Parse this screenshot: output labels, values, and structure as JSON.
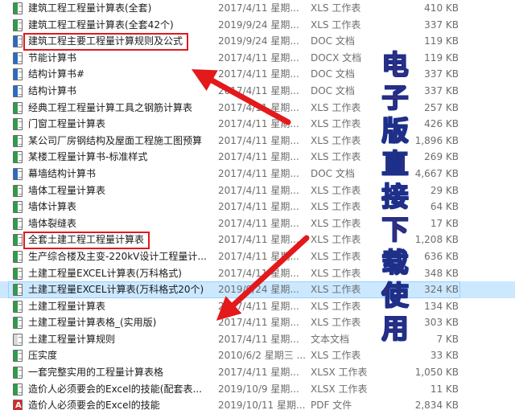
{
  "files": [
    {
      "name": "建筑工程工程量计算表(全套)",
      "date": "2017/4/11 星期...",
      "type": "XLS 工作表",
      "size": "410 KB",
      "icon": "xls-icon"
    },
    {
      "name": "建筑工程工程量计算表(全套42个)",
      "date": "2019/9/24 星期...",
      "type": "XLS 工作表",
      "size": "337 KB",
      "icon": "xls-icon"
    },
    {
      "name": "建筑工程主要工程量计算规则及公式",
      "date": "2019/9/24 星期...",
      "type": "DOC 文档",
      "size": "119 KB",
      "icon": "doc-icon"
    },
    {
      "name": "节能计算书",
      "date": "2017/4/11 星期...",
      "type": "DOCX 文档",
      "size": "119 KB",
      "icon": "docx-icon"
    },
    {
      "name": "结构计算书#",
      "date": "2017/4/11 星期...",
      "type": "DOC 文档",
      "size": "337 KB",
      "icon": "doc-icon"
    },
    {
      "name": "结构计算书",
      "date": "2017/4/11 星期...",
      "type": "DOC 文档",
      "size": "337 KB",
      "icon": "doc-icon"
    },
    {
      "name": "经典工程工程量计算工具之钢筋计算表",
      "date": "2017/4/11 星期...",
      "type": "XLS 工作表",
      "size": "257 KB",
      "icon": "xls-icon"
    },
    {
      "name": "门窗工程量计算表",
      "date": "2017/4/11 星期...",
      "type": "XLS 工作表",
      "size": "426 KB",
      "icon": "xls-icon"
    },
    {
      "name": "某公司厂房钢结构及屋面工程施工图预算",
      "date": "2017/4/11 星期...",
      "type": "XLS 工作表",
      "size": "1,896 KB",
      "icon": "xls-icon"
    },
    {
      "name": "某楼工程量计算书-标准样式",
      "date": "2017/4/11 星期...",
      "type": "XLS 工作表",
      "size": "269 KB",
      "icon": "xls-icon"
    },
    {
      "name": "幕墙结构计算书",
      "date": "2017/4/11 星期...",
      "type": "DOC 文档",
      "size": "4,667 KB",
      "icon": "doc-icon"
    },
    {
      "name": "墙体工程量计算表",
      "date": "2017/4/11 星期...",
      "type": "XLS 工作表",
      "size": "29 KB",
      "icon": "xls-icon"
    },
    {
      "name": "墙体计算表",
      "date": "2017/4/11 星期...",
      "type": "XLS 工作表",
      "size": "64 KB",
      "icon": "xls-icon"
    },
    {
      "name": "墙体裂缝表",
      "date": "2017/4/11 星期...",
      "type": "XLS 工作表",
      "size": "17 KB",
      "icon": "xls-icon"
    },
    {
      "name": "全套土建工程工程量计算表",
      "date": "2017/4/11 星期...",
      "type": "XLS 工作表",
      "size": "1,208 KB",
      "icon": "xls-icon"
    },
    {
      "name": "生产综合楼及主变-220kV设计工程量计...",
      "date": "2017/4/11 星期...",
      "type": "XLS 工作表",
      "size": "636 KB",
      "icon": "xls-icon"
    },
    {
      "name": "土建工程量EXCEL计算表(万科格式)",
      "date": "2017/4/11 星期...",
      "type": "XLS 工作表",
      "size": "348 KB",
      "icon": "xls-icon"
    },
    {
      "name": "土建工程量EXCEL计算表(万科格式20个)",
      "date": "2019/9/24 星期...",
      "type": "XLS 工作表",
      "size": "324 KB",
      "icon": "xls-icon",
      "selected": true
    },
    {
      "name": "土建工程量计算表",
      "date": "2017/4/11 星期...",
      "type": "XLS 工作表",
      "size": "134 KB",
      "icon": "xls-icon"
    },
    {
      "name": "土建工程量计算表格_(实用版)",
      "date": "2017/4/11 星期...",
      "type": "XLS 工作表",
      "size": "303 KB",
      "icon": "xls-icon"
    },
    {
      "name": "土建工程量计算规则",
      "date": "2017/4/11 星期...",
      "type": "文本文档",
      "size": "7 KB",
      "icon": "txt-icon"
    },
    {
      "name": "压实度",
      "date": "2010/6/2 星期三 ...",
      "type": "XLS 工作表",
      "size": "33 KB",
      "icon": "xls-icon"
    },
    {
      "name": "一套完整实用的工程量计算表格",
      "date": "2017/4/11 星期...",
      "type": "XLSX 工作表",
      "size": "1,050 KB",
      "icon": "xlsx-icon"
    },
    {
      "name": "造价人必须要会的Excel的技能(配套表...",
      "date": "2019/10/9 星期...",
      "type": "XLSX 工作表",
      "size": "11 KB",
      "icon": "xlsx-icon"
    },
    {
      "name": "造价人必须要会的Excel的技能",
      "date": "2019/10/11 星期...",
      "type": "PDF 文件",
      "size": "2,834 KB",
      "icon": "pdf-icon"
    }
  ],
  "overlay": {
    "vertical_text": [
      "电",
      "子",
      "版",
      "直",
      "接",
      "下",
      "载",
      "使",
      "用"
    ],
    "text_color": "#e3191c",
    "outline_color": "#1c2f8a",
    "arrow_color": "#e3191c",
    "highlighted_files": [
      "建筑工程主要工程量计算规则及公式",
      "全套土建工程工程量计算表"
    ]
  },
  "colors": {
    "selection": "#cce8ff",
    "excel_icon": "#2e9d4a",
    "word_icon": "#2b6cc4",
    "pdf_icon": "#d32b2b"
  }
}
